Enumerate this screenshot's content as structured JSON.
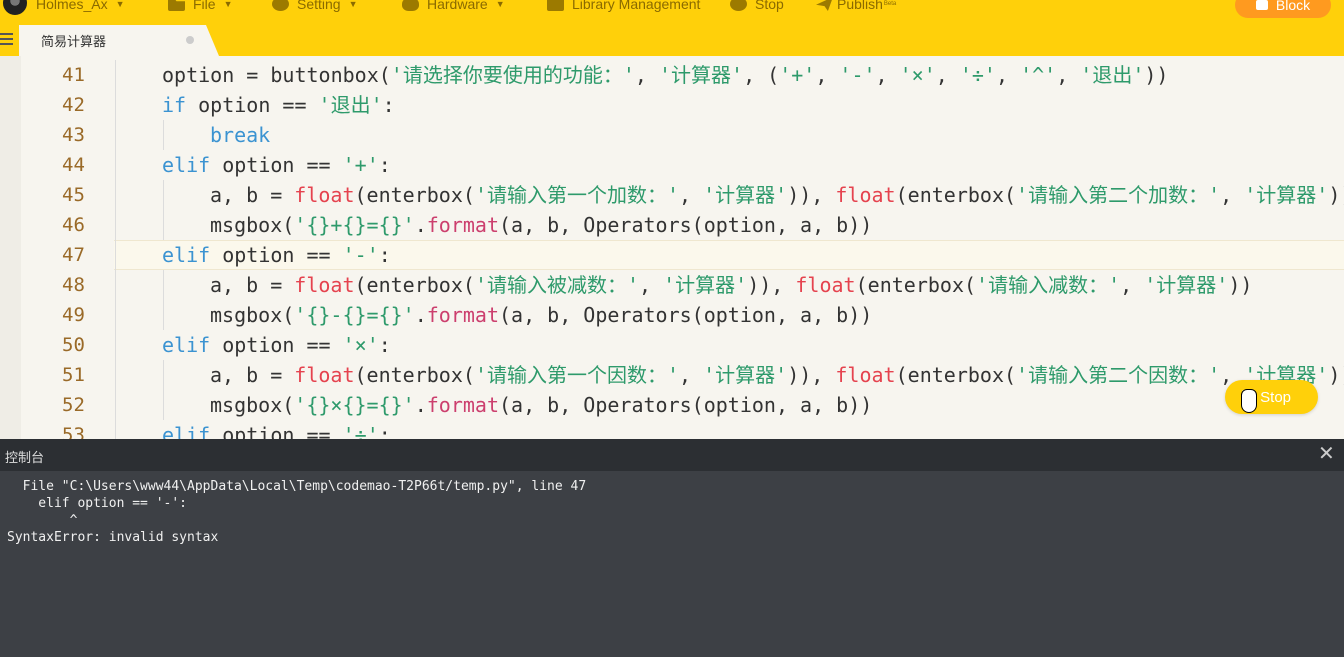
{
  "toolbar": {
    "user": "Holmes_Ax",
    "menus": [
      "File",
      "Setting",
      "Hardware",
      "Library Management",
      "Stop",
      "Publish"
    ],
    "publish_badge": "Beta",
    "block_label": "Block"
  },
  "tab": {
    "name": "简易计算器"
  },
  "editor": {
    "lines": [
      {
        "n": "41",
        "indent": 1,
        "parts": [
          [
            "",
            "option = buttonbox("
          ],
          [
            "s",
            "'请选择你要使用的功能：'"
          ],
          [
            "",
            ", "
          ],
          [
            "s",
            "'计算器'"
          ],
          [
            "",
            ", ("
          ],
          [
            "s",
            "'+'"
          ],
          [
            "",
            ", "
          ],
          [
            "s",
            "'-'"
          ],
          [
            "",
            ", "
          ],
          [
            "s",
            "'×'"
          ],
          [
            "",
            ", "
          ],
          [
            "s",
            "'÷'"
          ],
          [
            "",
            ", "
          ],
          [
            "s",
            "'^'"
          ],
          [
            "",
            ", "
          ],
          [
            "s",
            "'退出'"
          ],
          [
            "",
            "))"
          ]
        ]
      },
      {
        "n": "42",
        "indent": 1,
        "parts": [
          [
            "k",
            "if"
          ],
          [
            "",
            " option == "
          ],
          [
            "s",
            "'退出'"
          ],
          [
            "",
            ":"
          ]
        ]
      },
      {
        "n": "43",
        "indent": 2,
        "parts": [
          [
            "k",
            "break"
          ]
        ]
      },
      {
        "n": "44",
        "indent": 1,
        "parts": [
          [
            "k",
            "elif"
          ],
          [
            "",
            " option == "
          ],
          [
            "s",
            "'+'"
          ],
          [
            "",
            ":"
          ]
        ]
      },
      {
        "n": "45",
        "indent": 2,
        "parts": [
          [
            "",
            "a, b = "
          ],
          [
            "f",
            "float"
          ],
          [
            "",
            "(enterbox("
          ],
          [
            "s",
            "'请输入第一个加数：'"
          ],
          [
            "",
            ", "
          ],
          [
            "s",
            "'计算器'"
          ],
          [
            "",
            ")), "
          ],
          [
            "f",
            "float"
          ],
          [
            "",
            "(enterbox("
          ],
          [
            "s",
            "'请输入第二个加数：'"
          ],
          [
            "",
            ", "
          ],
          [
            "s",
            "'计算器'"
          ],
          [
            "",
            "))"
          ]
        ]
      },
      {
        "n": "46",
        "indent": 2,
        "parts": [
          [
            "",
            "msgbox("
          ],
          [
            "s",
            "'{}+{}={}'"
          ],
          [
            "",
            "."
          ],
          [
            "m",
            "format"
          ],
          [
            "",
            "(a, b, Operators(option, a, b))"
          ]
        ]
      },
      {
        "n": "47",
        "indent": 1,
        "active": true,
        "parts": [
          [
            "k",
            "elif"
          ],
          [
            "",
            " option == "
          ],
          [
            "s",
            "'-'"
          ],
          [
            "",
            ":"
          ]
        ]
      },
      {
        "n": "48",
        "indent": 2,
        "parts": [
          [
            "",
            "a, b = "
          ],
          [
            "f",
            "float"
          ],
          [
            "",
            "(enterbox("
          ],
          [
            "s",
            "'请输入被减数：'"
          ],
          [
            "",
            ", "
          ],
          [
            "s",
            "'计算器'"
          ],
          [
            "",
            ")), "
          ],
          [
            "f",
            "float"
          ],
          [
            "",
            "(enterbox("
          ],
          [
            "s",
            "'请输入减数：'"
          ],
          [
            "",
            ", "
          ],
          [
            "s",
            "'计算器'"
          ],
          [
            "",
            "))"
          ]
        ]
      },
      {
        "n": "49",
        "indent": 2,
        "parts": [
          [
            "",
            "msgbox("
          ],
          [
            "s",
            "'{}-{}={}'"
          ],
          [
            "",
            "."
          ],
          [
            "m",
            "format"
          ],
          [
            "",
            "(a, b, Operators(option, a, b))"
          ]
        ]
      },
      {
        "n": "50",
        "indent": 1,
        "parts": [
          [
            "k",
            "elif"
          ],
          [
            "",
            " option == "
          ],
          [
            "s",
            "'×'"
          ],
          [
            "",
            ":"
          ]
        ]
      },
      {
        "n": "51",
        "indent": 2,
        "parts": [
          [
            "",
            "a, b = "
          ],
          [
            "f",
            "float"
          ],
          [
            "",
            "(enterbox("
          ],
          [
            "s",
            "'请输入第一个因数：'"
          ],
          [
            "",
            ", "
          ],
          [
            "s",
            "'计算器'"
          ],
          [
            "",
            ")), "
          ],
          [
            "f",
            "float"
          ],
          [
            "",
            "(enterbox("
          ],
          [
            "s",
            "'请输入第二个因数：'"
          ],
          [
            "",
            ", "
          ],
          [
            "s",
            "'计算器'"
          ],
          [
            "",
            "))"
          ]
        ]
      },
      {
        "n": "52",
        "indent": 2,
        "parts": [
          [
            "",
            "msgbox("
          ],
          [
            "s",
            "'{}×{}={}'"
          ],
          [
            "",
            "."
          ],
          [
            "m",
            "format"
          ],
          [
            "",
            "(a, b, Operators(option, a, b))"
          ]
        ]
      },
      {
        "n": "53",
        "indent": 1,
        "parts": [
          [
            "k",
            "elif"
          ],
          [
            "",
            " option == "
          ],
          [
            "s",
            "'÷'"
          ],
          [
            "",
            ":"
          ]
        ]
      }
    ]
  },
  "float_stop_label": "Stop",
  "console": {
    "title": "控制台",
    "close_glyph": "✕",
    "lines": [
      "  File \"C:\\Users\\www44\\AppData\\Local\\Temp\\codemao-T2P66t/temp.py\", line 47",
      "    elif option == '-':",
      "        ^",
      "SyntaxError: invalid syntax"
    ]
  }
}
